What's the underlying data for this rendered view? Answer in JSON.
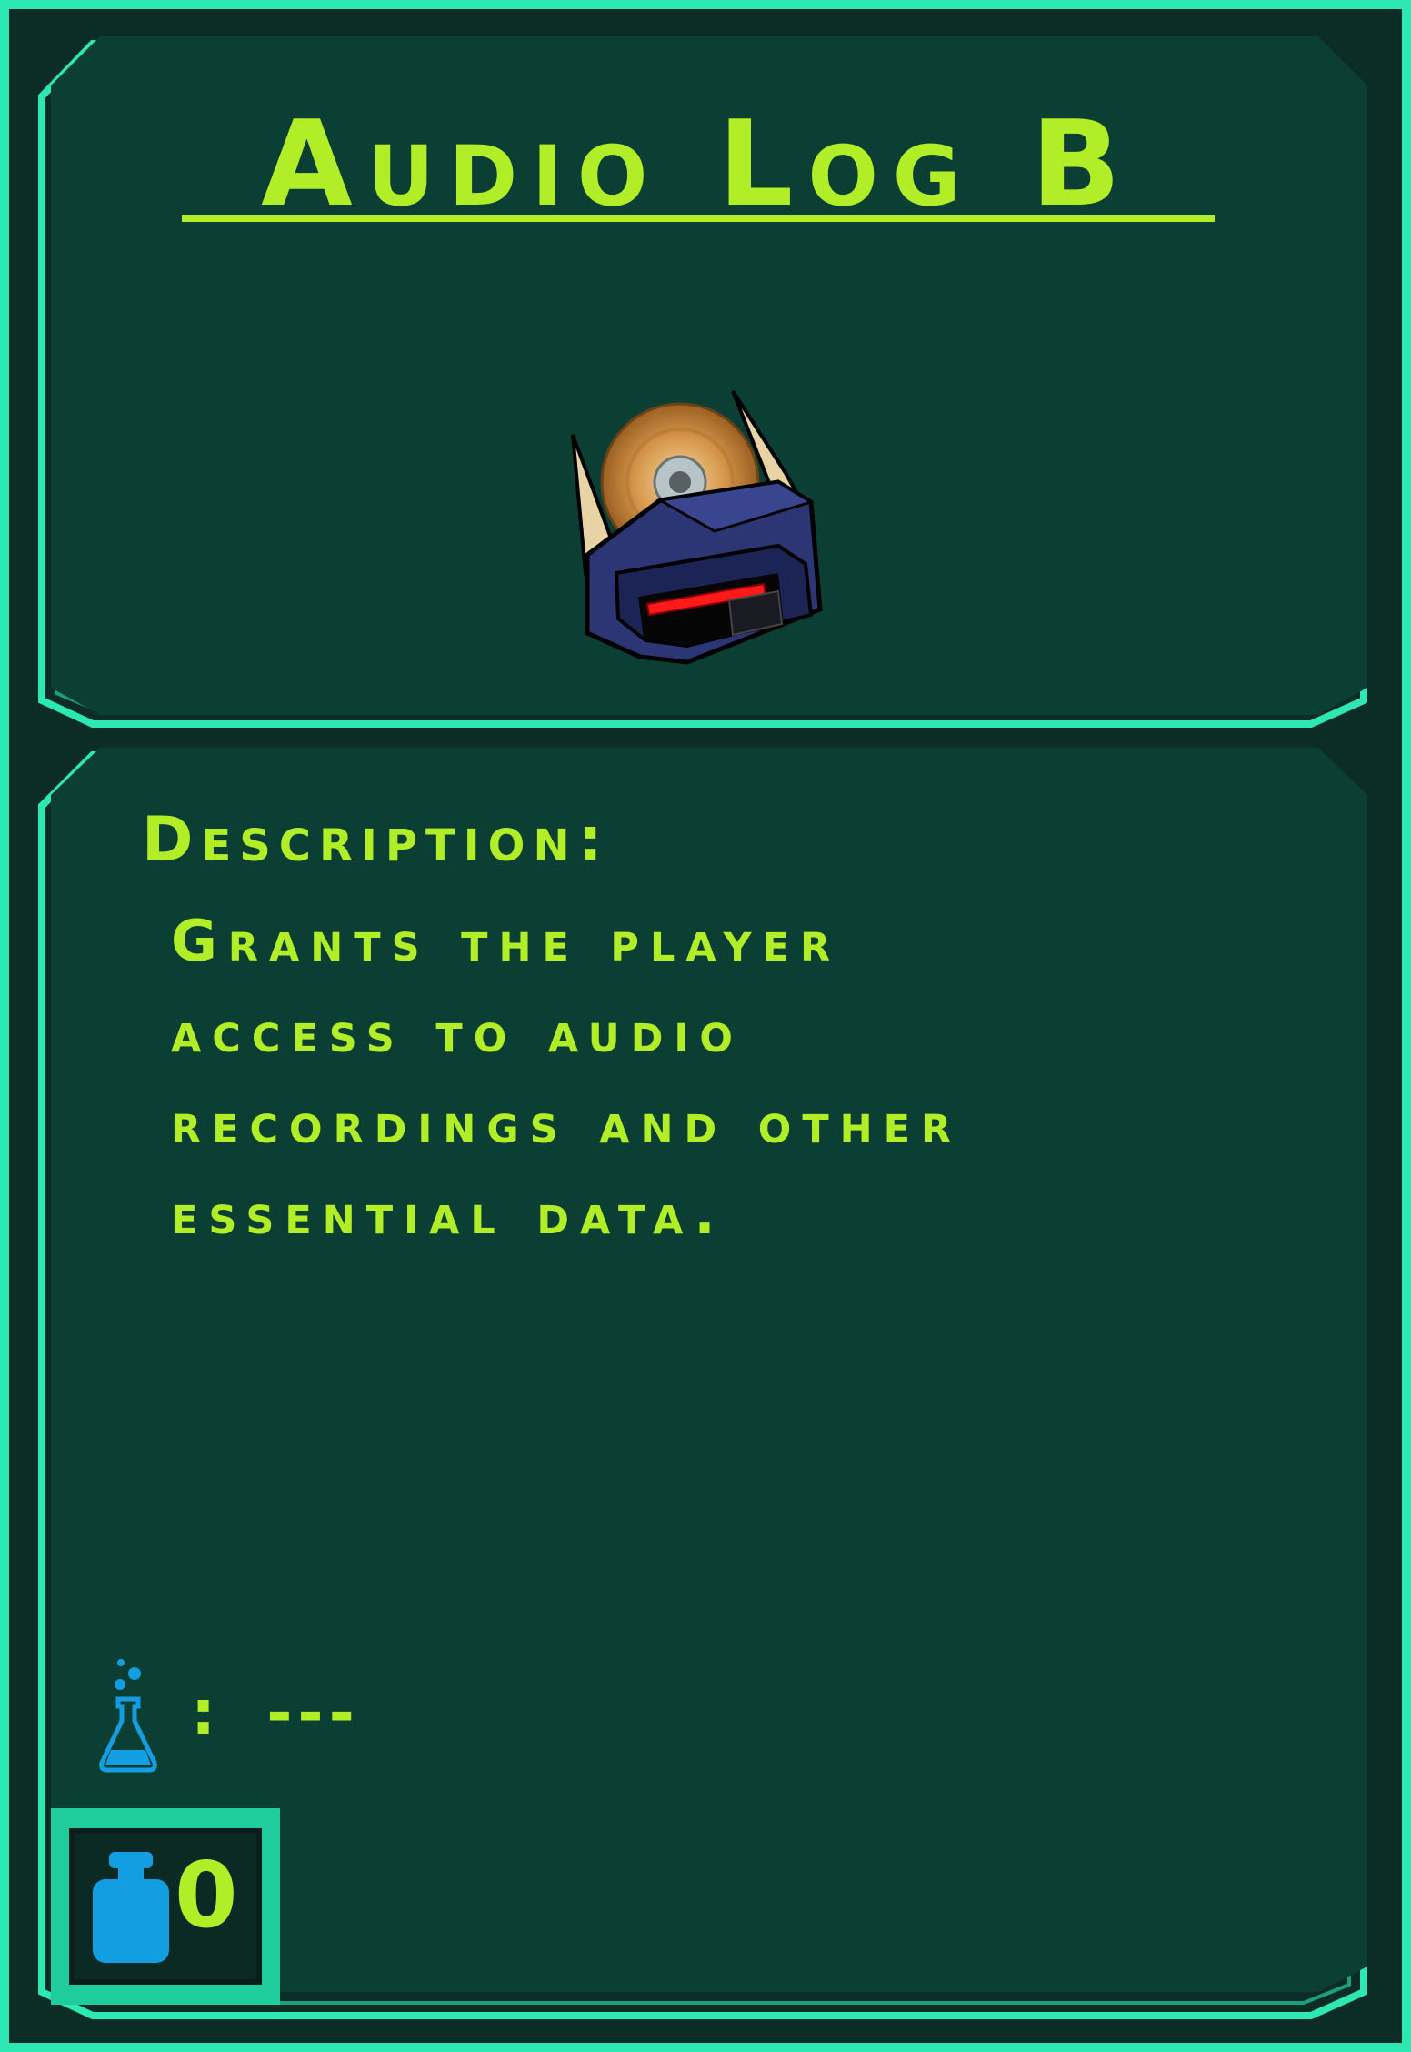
{
  "item": {
    "title": "Audio Log B",
    "icon": "audio-log-disc-device-icon"
  },
  "description": {
    "label": "Description:",
    "text": "Grants the player\naccess to audio\nrecordings and other\nessential data."
  },
  "stats": {
    "research_icon": "flask-icon",
    "research_colon": ":",
    "research_value": "---",
    "weight_icon": "weight-icon",
    "weight_value": "0"
  },
  "colors": {
    "frame": "#2ee8b4",
    "panel": "#0b3f33",
    "text": "#b2ee27",
    "icon_blue": "#129ee0"
  }
}
